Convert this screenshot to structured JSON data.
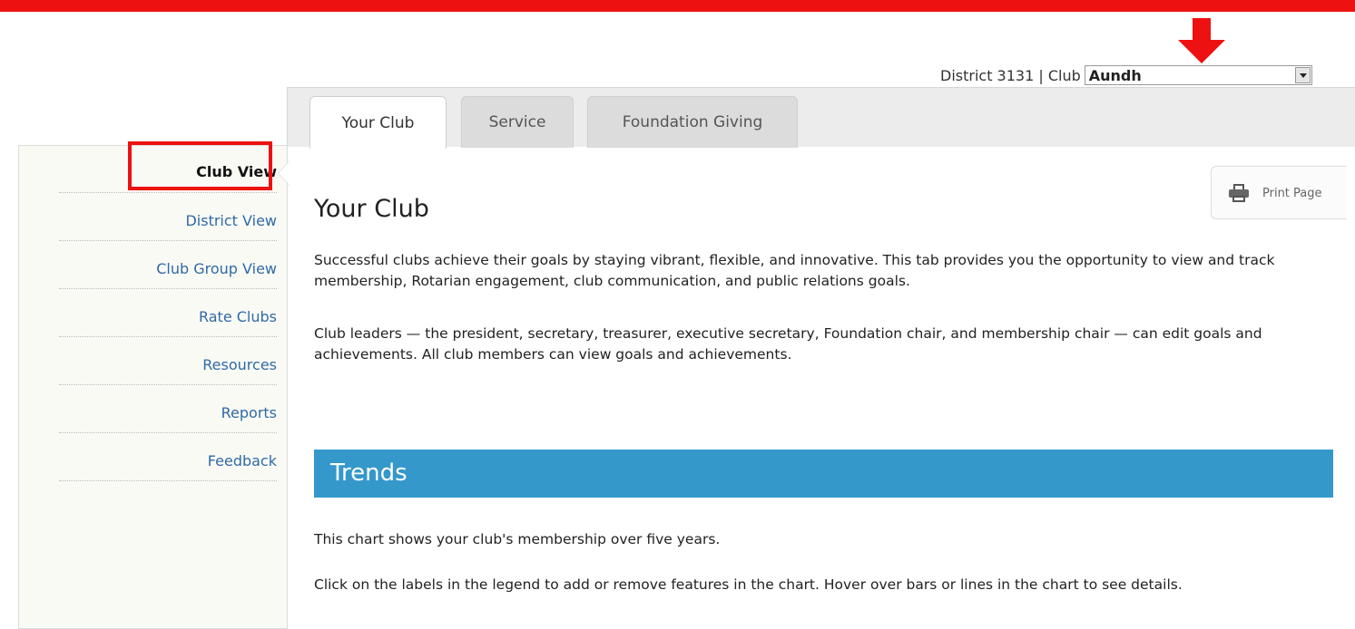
{
  "header": {
    "district_label": "District 3131 | Club",
    "club_selected": "Aundh"
  },
  "tabs": [
    {
      "label": "Your Club",
      "active": true
    },
    {
      "label": "Service",
      "active": false
    },
    {
      "label": "Foundation Giving",
      "active": false
    }
  ],
  "sidebar": {
    "items": [
      {
        "label": "Club View",
        "active": true
      },
      {
        "label": "District View",
        "active": false
      },
      {
        "label": "Club Group View",
        "active": false
      },
      {
        "label": "Rate Clubs",
        "active": false
      },
      {
        "label": "Resources",
        "active": false
      },
      {
        "label": "Reports",
        "active": false
      },
      {
        "label": "Feedback",
        "active": false
      }
    ]
  },
  "main": {
    "title": "Your Club",
    "print_label": "Print Page",
    "intro_1": "Successful clubs achieve their goals by staying vibrant, flexible, and innovative. This tab provides you the opportunity to view and track membership, Rotarian engagement, club communication, and public relations goals.",
    "intro_2": "Club leaders — the president, secretary, treasurer, executive secretary, Foundation chair, and membership chair — can edit goals and achievements. All club members can view goals and achievements.",
    "trends_title": "Trends",
    "trends_desc": "This chart shows your club's membership over five years.",
    "trends_hint": "Click on the labels in the legend to add or remove features in the chart. Hover over bars or lines in the chart to see details."
  },
  "colors": {
    "annotation_red": "#ee1111",
    "link_blue": "#2f6aa6",
    "section_blue": "#3598cb"
  }
}
